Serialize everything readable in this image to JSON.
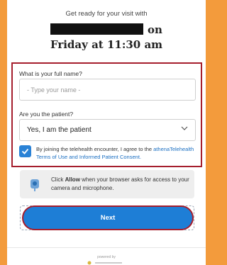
{
  "header": {
    "intro": "Get ready for your visit with",
    "on": "on",
    "datetime": "Friday at 11:30 am"
  },
  "form": {
    "name_label": "What is your full name?",
    "name_placeholder": "- Type your name -",
    "patient_label": "Are you the patient?",
    "patient_value": "Yes, I am the patient",
    "consent_checked": true,
    "consent_text": "By joining the telehealth encounter, I agree to the",
    "consent_link_1": "athenaTelehealth",
    "consent_link_2": "Terms of Use and Informed Patient Consent."
  },
  "notice": {
    "before": "Click",
    "bold": "Allow",
    "after": "when your browser asks for access to your camera and microphone."
  },
  "actions": {
    "next_label": "Next"
  },
  "footer": {
    "powered_by": "powered by"
  },
  "colors": {
    "accent": "#1e7ed6",
    "border_highlight": "#a51e2d",
    "page_bg": "#f39b3c"
  }
}
